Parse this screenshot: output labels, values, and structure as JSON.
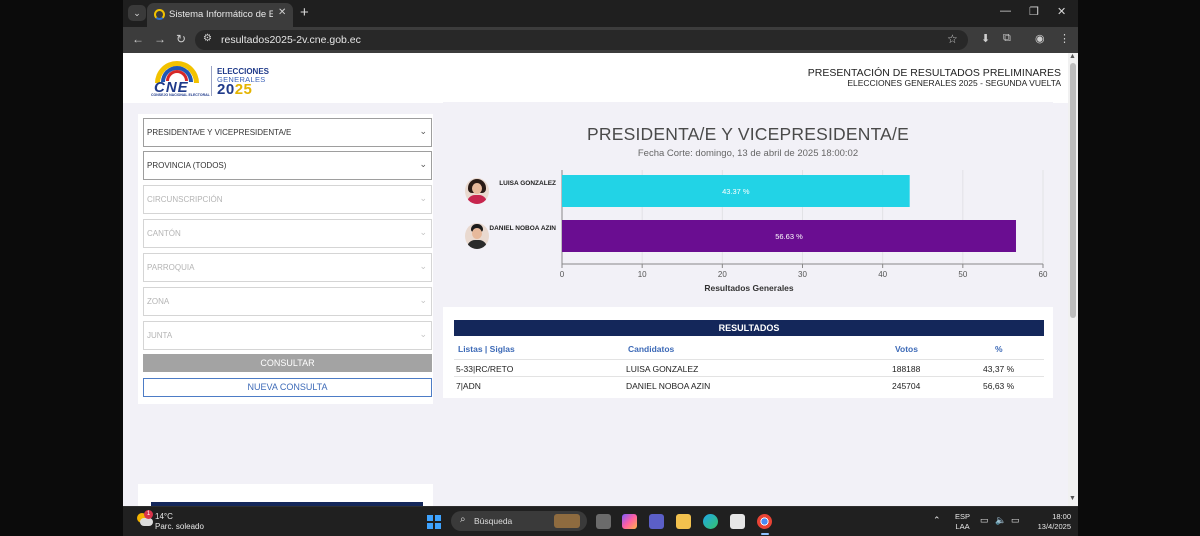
{
  "browser": {
    "tab_title": "Sistema Informático de Escrutinio",
    "url": "resultados2025-2v.cne.gob.ec"
  },
  "header": {
    "logo_text": "CNE",
    "logo_subtext": "CONSEJO NACIONAL ELECTORAL",
    "elecciones_line1": "ELECCIONES",
    "elecciones_line2": "GENERALES",
    "elecciones_year_a": "20",
    "elecciones_year_b": "25",
    "title": "PRESENTACIÓN DE RESULTADOS PRELIMINARES",
    "subtitle": "ELECCIONES GENERALES 2025 - SEGUNDA VUELTA"
  },
  "filters": {
    "dignidad": "PRESIDENTA/E Y VICEPRESIDENTA/E",
    "provincia": "PROVINCIA (TODOS)",
    "circunscripcion": "CIRCUNSCRIPCIÓN",
    "canton": "CANTÓN",
    "parroquia": "PARROQUIA",
    "zona": "ZONA",
    "junta": "JUNTA",
    "consultar_label": "CONSULTAR",
    "nueva_consulta_label": "NUEVA CONSULTA"
  },
  "chart": {
    "title": "PRESIDENTA/E Y VICEPRESIDENTA/E",
    "date_line": "Fecha Corte: domingo, 13 de abril de 2025 18:00:02",
    "xlabel": "Resultados Generales"
  },
  "chart_data": {
    "type": "bar",
    "orientation": "horizontal",
    "categories": [
      "LUISA GONZALEZ",
      "DANIEL NOBOA AZIN"
    ],
    "values": [
      43.37,
      56.63
    ],
    "value_labels": [
      "43.37 %",
      "56.63 %"
    ],
    "colors": [
      "#22d3e6",
      "#6a0d91"
    ],
    "xlim": [
      0,
      60
    ],
    "xticks": [
      0,
      10,
      20,
      30,
      40,
      50,
      60
    ],
    "xlabel": "Resultados Generales",
    "title": "PRESIDENTA/E Y VICEPRESIDENTA/E"
  },
  "results": {
    "heading": "RESULTADOS",
    "columns": {
      "listas": "Listas | Siglas",
      "candidatos": "Candidatos",
      "votos": "Votos",
      "pct": "%"
    },
    "rows": [
      {
        "lista": "5-33|RC/RETO",
        "candidato": "LUISA GONZALEZ",
        "votos": "188188",
        "pct": "43,37 %"
      },
      {
        "lista": "7|ADN",
        "candidato": "DANIEL NOBOA AZIN",
        "votos": "245704",
        "pct": "56,63 %"
      }
    ]
  },
  "taskbar": {
    "temperature": "14°C",
    "condition": "Parc. soleado",
    "weather_badge": "1",
    "search_placeholder": "Búsqueda",
    "lang_line1": "ESP",
    "lang_line2": "LAA",
    "time": "18:00",
    "date": "13/4/2025"
  },
  "colors": {
    "navy": "#14275a",
    "link_blue": "#3d6ab7",
    "bar_cyan": "#22d3e6",
    "bar_purple": "#6a0d91"
  }
}
